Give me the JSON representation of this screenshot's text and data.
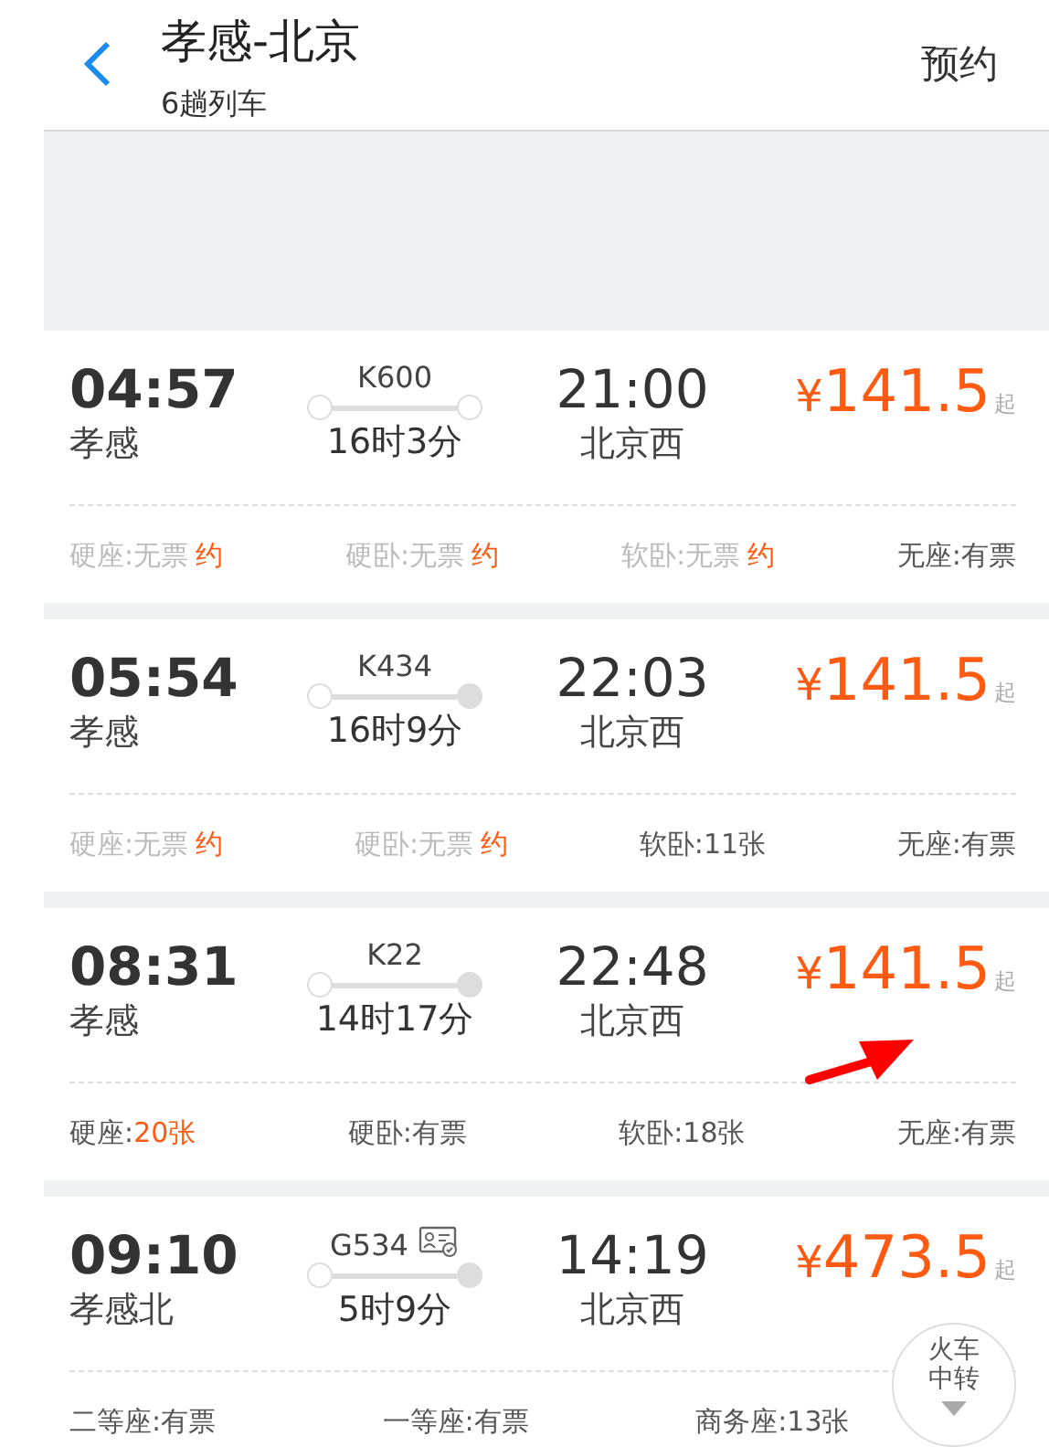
{
  "header": {
    "title": "孝感-北京",
    "subtitle": "6趟列车",
    "action": "预约"
  },
  "trains": [
    {
      "depart_time": "04:57",
      "depart_station": "孝感",
      "train_no": "K600",
      "id_icon": false,
      "duration": "16时3分",
      "arrive_time": "21:00",
      "arrive_station": "北京西",
      "arrival_dot_filled": false,
      "price_symbol": "¥",
      "price": "141.5",
      "price_suffix": "起",
      "marked": false,
      "seats": [
        {
          "label": "硬座:",
          "value": "无票",
          "kind": "sold_out",
          "booking": "约"
        },
        {
          "label": "硬卧:",
          "value": "无票",
          "kind": "sold_out",
          "booking": "约"
        },
        {
          "label": "软卧:",
          "value": "无票",
          "kind": "sold_out",
          "booking": "约"
        },
        {
          "label": "无座:",
          "value": "有票",
          "kind": "available"
        }
      ]
    },
    {
      "depart_time": "05:54",
      "depart_station": "孝感",
      "train_no": "K434",
      "id_icon": false,
      "duration": "16时9分",
      "arrive_time": "22:03",
      "arrive_station": "北京西",
      "arrival_dot_filled": true,
      "price_symbol": "¥",
      "price": "141.5",
      "price_suffix": "起",
      "marked": false,
      "seats": [
        {
          "label": "硬座:",
          "value": "无票",
          "kind": "sold_out",
          "booking": "约"
        },
        {
          "label": "硬卧:",
          "value": "无票",
          "kind": "sold_out",
          "booking": "约"
        },
        {
          "label": "软卧:",
          "value": "11张",
          "kind": "available"
        },
        {
          "label": "无座:",
          "value": "有票",
          "kind": "available"
        }
      ]
    },
    {
      "depart_time": "08:31",
      "depart_station": "孝感",
      "train_no": "K22",
      "id_icon": false,
      "duration": "14时17分",
      "arrive_time": "22:48",
      "arrive_station": "北京西",
      "arrival_dot_filled": true,
      "price_symbol": "¥",
      "price": "141.5",
      "price_suffix": "起",
      "marked": true,
      "seats": [
        {
          "label": "硬座:",
          "value": "20张",
          "kind": "few"
        },
        {
          "label": "硬卧:",
          "value": "有票",
          "kind": "available"
        },
        {
          "label": "软卧:",
          "value": "18张",
          "kind": "available"
        },
        {
          "label": "无座:",
          "value": "有票",
          "kind": "available"
        }
      ]
    },
    {
      "depart_time": "09:10",
      "depart_station": "孝感北",
      "train_no": "G534",
      "id_icon": true,
      "duration": "5时9分",
      "arrive_time": "14:19",
      "arrive_station": "北京西",
      "arrival_dot_filled": true,
      "price_symbol": "¥",
      "price": "473.5",
      "price_suffix": "起",
      "marked": false,
      "seats": [
        {
          "label": "二等座:",
          "value": "有票",
          "kind": "available"
        },
        {
          "label": "一等座:",
          "value": "有票",
          "kind": "available"
        },
        {
          "label": "商务座:",
          "value": "13张",
          "kind": "available"
        }
      ]
    }
  ],
  "transfer_button": {
    "label": "火车中转"
  }
}
